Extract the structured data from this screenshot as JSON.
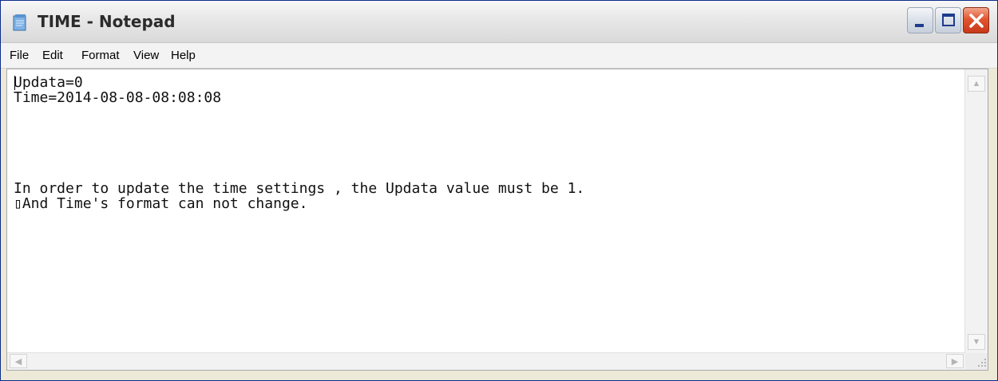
{
  "window": {
    "title": "TIME - Notepad",
    "icons": {
      "app": "notepad-icon",
      "minimize": "minimize-icon",
      "maximize": "maximize-icon",
      "close": "close-icon"
    },
    "colors": {
      "close_button": "#e0562f",
      "title_text": "#2b2b2b"
    }
  },
  "menu": {
    "file": "File",
    "edit": "Edit",
    "format": "Format",
    "view": "View",
    "help": "Help"
  },
  "editor": {
    "content": "Updata=0\nTime=2014-08-08-08:08:08\n\n\n\n\n\nIn order to update the time settings , the Updata value must be 1.\n▯And Time's format can not change.",
    "vscroll_up": "▲",
    "vscroll_down": "▼",
    "hscroll_left": "◀",
    "hscroll_right": "▶"
  }
}
